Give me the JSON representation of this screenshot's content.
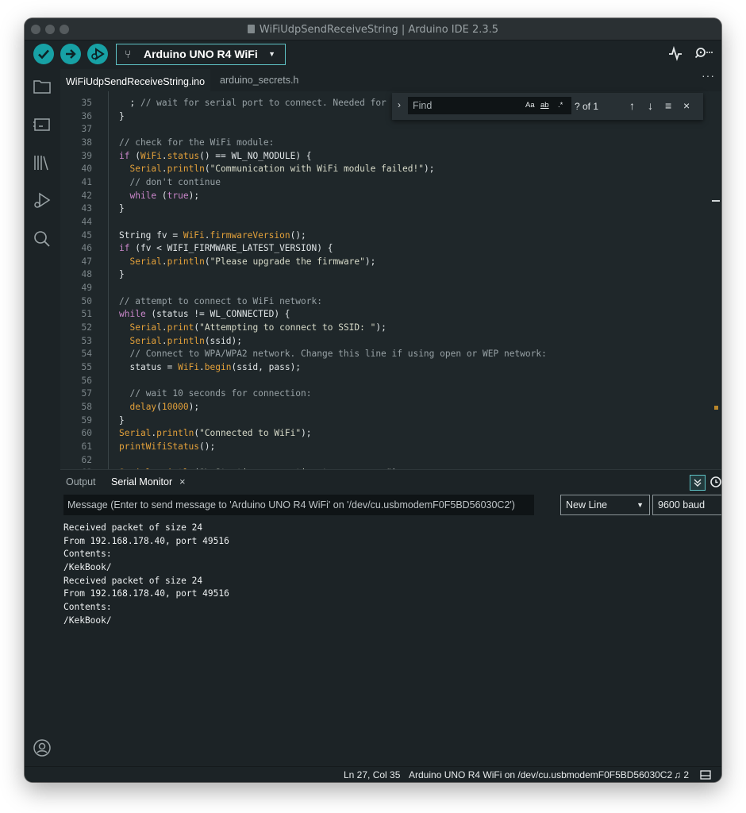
{
  "window": {
    "title": "WiFiUdpSendReceiveString | Arduino IDE 2.3.5"
  },
  "toolbar": {
    "verify_icon": "check-icon",
    "upload_icon": "arrow-right-icon",
    "debug_icon": "debug-icon",
    "board": "Arduino UNO R4 WiFi",
    "serial_plotter_icon": "pulse-icon",
    "serial_monitor_icon": "magnifier-dots-icon"
  },
  "activity_bar": [
    "folder-icon",
    "board-icon",
    "library-icon",
    "debug-icon",
    "search-icon",
    "account-icon"
  ],
  "tabs": [
    {
      "label": "WiFiUdpSendReceiveString.ino",
      "active": true
    },
    {
      "label": "arduino_secrets.h",
      "active": false
    }
  ],
  "tabs_more": "···",
  "find": {
    "placeholder": "Find",
    "match_case": "Aa",
    "whole_word": "ab",
    "regex": ".*",
    "count": "? of 1"
  },
  "code": [
    {
      "n": "35",
      "t": "  ; // wait for serial port to connect. Needed for n"
    },
    {
      "n": "36",
      "t": "}"
    },
    {
      "n": "37",
      "t": ""
    },
    {
      "n": "38",
      "t": "// check for the WiFi module:"
    },
    {
      "n": "39",
      "t": "if (WiFi.status() == WL_NO_MODULE) {"
    },
    {
      "n": "40",
      "t": "  Serial.println(\"Communication with WiFi module failed!\");"
    },
    {
      "n": "41",
      "t": "  // don't continue"
    },
    {
      "n": "42",
      "t": "  while (true);"
    },
    {
      "n": "43",
      "t": "}"
    },
    {
      "n": "44",
      "t": ""
    },
    {
      "n": "45",
      "t": "String fv = WiFi.firmwareVersion();"
    },
    {
      "n": "46",
      "t": "if (fv < WIFI_FIRMWARE_LATEST_VERSION) {"
    },
    {
      "n": "47",
      "t": "  Serial.println(\"Please upgrade the firmware\");"
    },
    {
      "n": "48",
      "t": "}"
    },
    {
      "n": "49",
      "t": ""
    },
    {
      "n": "50",
      "t": "// attempt to connect to WiFi network:"
    },
    {
      "n": "51",
      "t": "while (status != WL_CONNECTED) {"
    },
    {
      "n": "52",
      "t": "  Serial.print(\"Attempting to connect to SSID: \");"
    },
    {
      "n": "53",
      "t": "  Serial.println(ssid);"
    },
    {
      "n": "54",
      "t": "  // Connect to WPA/WPA2 network. Change this line if using open or WEP network:"
    },
    {
      "n": "55",
      "t": "  status = WiFi.begin(ssid, pass);"
    },
    {
      "n": "56",
      "t": ""
    },
    {
      "n": "57",
      "t": "  // wait 10 seconds for connection:"
    },
    {
      "n": "58",
      "t": "  delay(10000);"
    },
    {
      "n": "59",
      "t": "}"
    },
    {
      "n": "60",
      "t": "Serial.println(\"Connected to WiFi\");"
    },
    {
      "n": "61",
      "t": "printWifiStatus();"
    },
    {
      "n": "62",
      "t": ""
    },
    {
      "n": "63",
      "t": "Serial.println(\"\\nStarting connection to server...\");"
    }
  ],
  "panel": {
    "output_tab": "Output",
    "serial_tab": "Serial Monitor",
    "close": "×",
    "autoscroll_icon": "autoscroll-icon",
    "timestamp_icon": "clock-icon",
    "clear_icon": "clear-output-icon",
    "message_placeholder": "Message (Enter to send message to 'Arduino UNO R4 WiFi' on '/dev/cu.usbmodemF0F5BD56030C2')",
    "line_ending": "New Line",
    "baud": "9600 baud",
    "output": [
      "Received packet of size 24",
      "From 192.168.178.40, port 49516",
      "Contents:",
      "/KekBook/",
      "Received packet of size 24",
      "From 192.168.178.40, port 49516",
      "Contents:",
      "/KekBook/"
    ]
  },
  "status": {
    "position": "Ln 27, Col 35",
    "board": "Arduino UNO R4 WiFi on /dev/cu.usbmodemF0F5BD56030C2",
    "notifications": "2"
  },
  "colors": {
    "accent": "#17a1a5",
    "background": "#1c2326",
    "editor": "#1f272a",
    "keyword": "#c986c9",
    "function": "#e2a03a"
  }
}
